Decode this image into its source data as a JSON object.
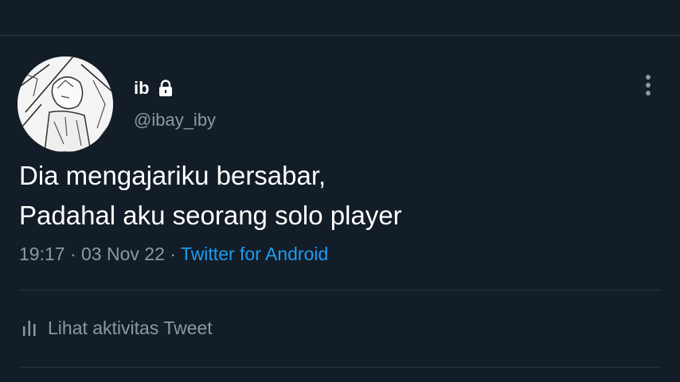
{
  "tweet": {
    "display_name": "ib",
    "handle": "@ibay_iby",
    "text_lines": [
      "Dia mengajariku bersabar,",
      "Padahal aku seorang solo player"
    ],
    "time": "19:17",
    "date": "03 Nov 22",
    "separator": "·",
    "source": "Twitter for Android",
    "activity_label": "Lihat aktivitas Tweet"
  },
  "icons": {
    "lock": "lock-icon",
    "more": "more-vertical-icon",
    "activity": "bar-chart-icon"
  },
  "colors": {
    "background": "#131d27",
    "text": "#ffffff",
    "secondary": "#8b98a5",
    "link": "#1d9bf0",
    "divider": "#2a3642"
  }
}
